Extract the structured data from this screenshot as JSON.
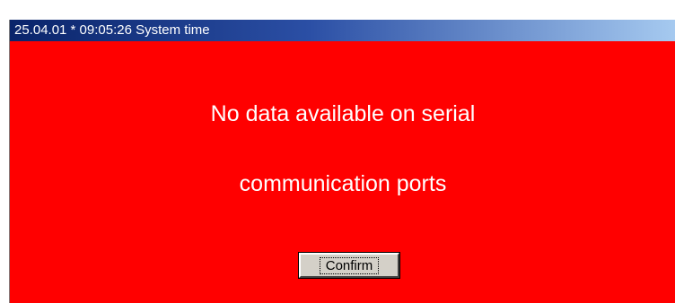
{
  "window": {
    "title": "25.04.01 * 09:05:26 System time",
    "background_color": "#ff0000"
  },
  "message": {
    "line1": "No data available on serial",
    "line2": "communication ports",
    "text_color": "#ffffff"
  },
  "buttons": {
    "confirm_label": "Confirm"
  }
}
